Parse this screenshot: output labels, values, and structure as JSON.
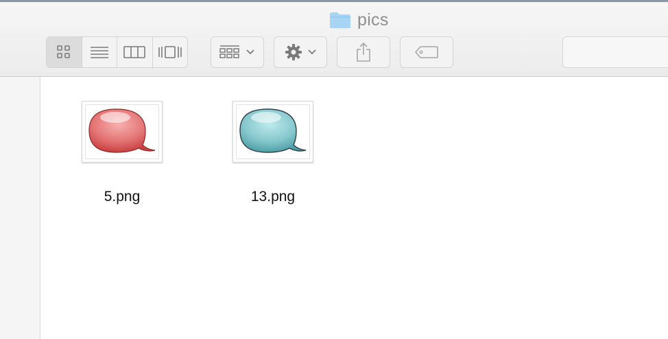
{
  "window": {
    "title": "pics",
    "title_icon": "folder-icon"
  },
  "toolbar": {
    "view_modes": [
      {
        "name": "icon-view",
        "icon": "grid-icon",
        "active": true
      },
      {
        "name": "list-view",
        "icon": "list-icon",
        "active": false
      },
      {
        "name": "column-view",
        "icon": "columns-icon",
        "active": false
      },
      {
        "name": "cover-flow-view",
        "icon": "cover-flow-icon",
        "active": false
      }
    ],
    "arrange_icon": "arrange-icon",
    "action_icon": "gear-icon",
    "share_icon": "share-icon",
    "tag_icon": "tag-icon"
  },
  "files": [
    {
      "name": "5.png",
      "color": "#e24a4a",
      "highlight": "#f7b0b0"
    },
    {
      "name": "13.png",
      "color": "#4e9fa6",
      "highlight": "#b8e6ea"
    }
  ],
  "colors": {
    "accent_folder": "#a8d4f4"
  }
}
